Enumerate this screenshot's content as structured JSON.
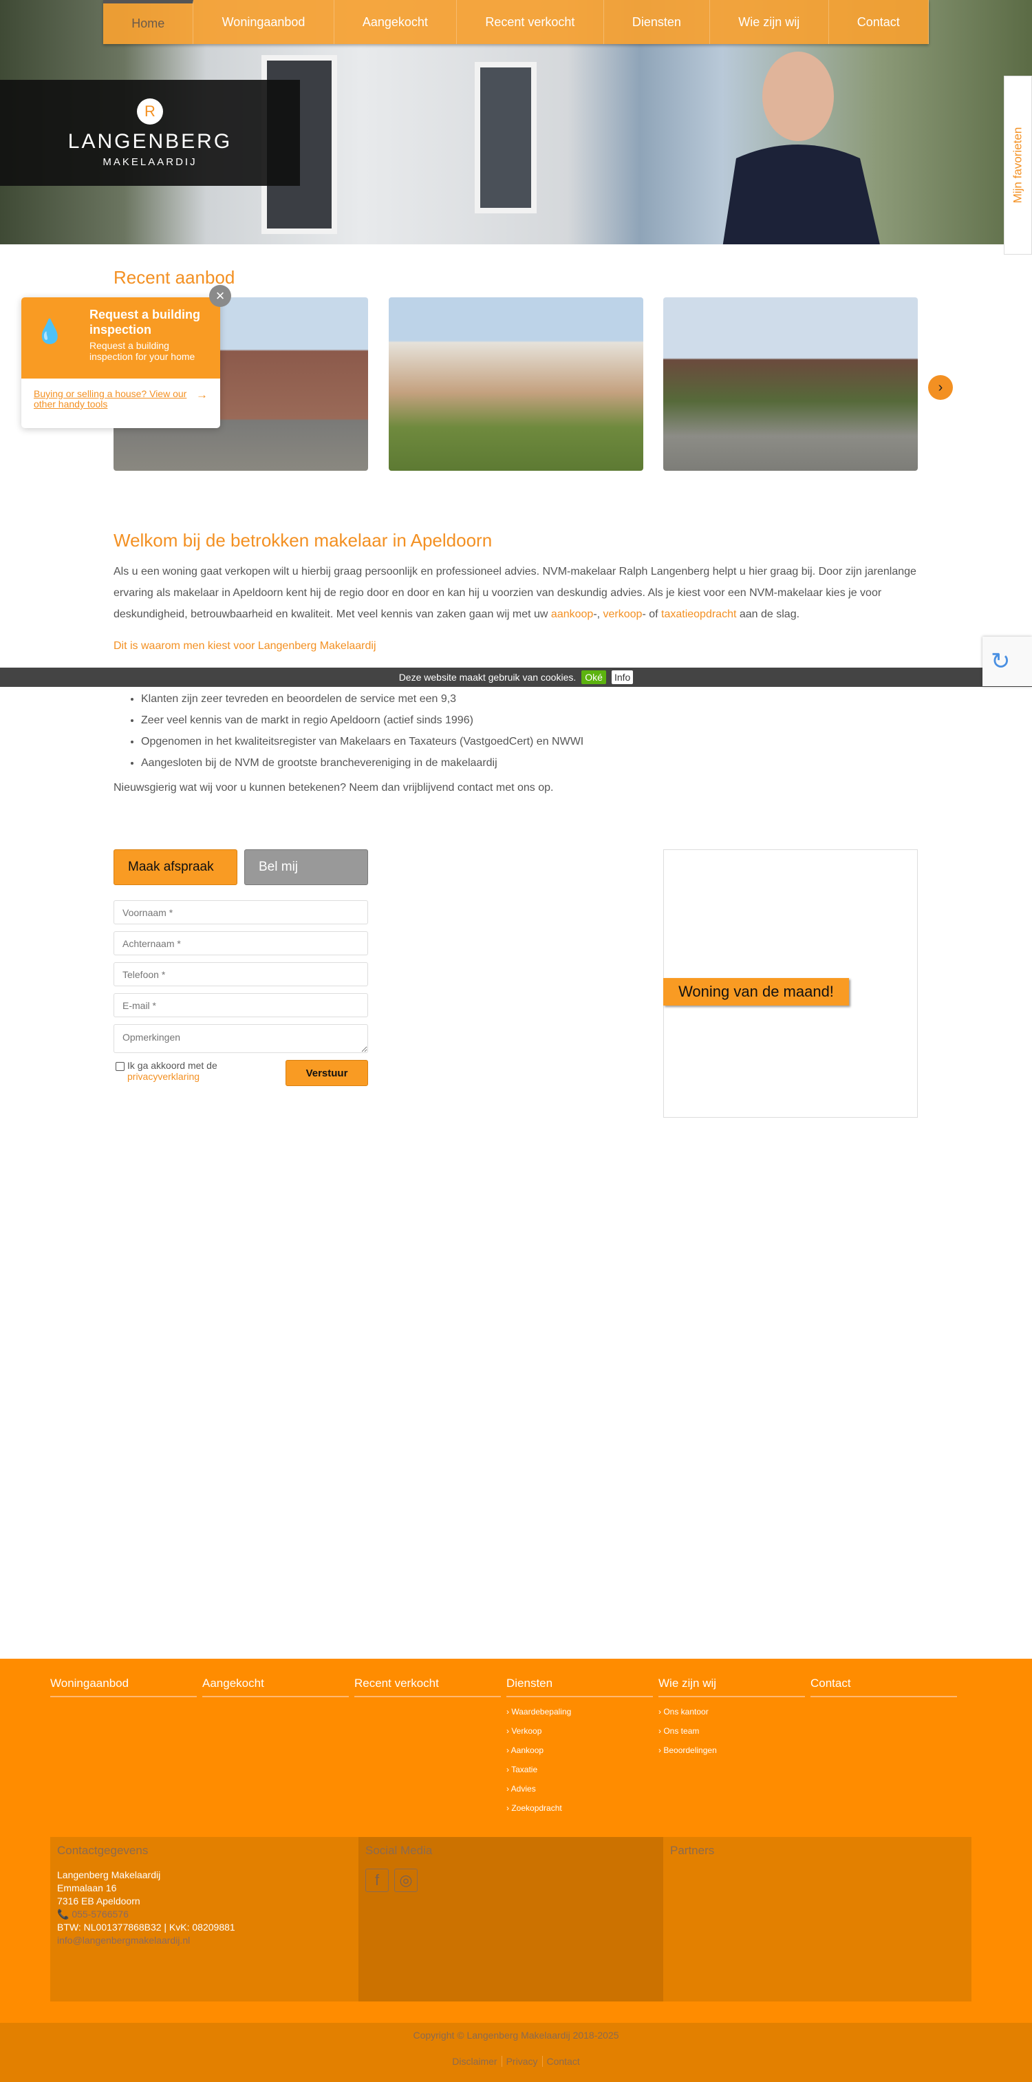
{
  "nav": {
    "items": [
      "Home",
      "Woningaanbod",
      "Aangekocht",
      "Recent verkocht",
      "Diensten",
      "Wie zijn wij",
      "Contact"
    ],
    "active": "Home"
  },
  "logo": {
    "letter": "R",
    "name": "LANGENBERG",
    "sub": "MAKELAARDIJ"
  },
  "favorites_tab": "Mijn favorieten",
  "recent": {
    "title": "Recent aanbod",
    "next_icon": "chevron-right-icon"
  },
  "popup": {
    "title": "Request a building inspection",
    "subtitle": "Request a building inspection for your home",
    "link": "Buying or selling a house? View our other handy tools",
    "close_icon": "close-icon"
  },
  "welcome": {
    "title": "Welkom bij de betrokken makelaar in Apeldoorn",
    "intro_before": "Als u een woning gaat verkopen wilt u hierbij graag persoonlijk en professioneel advies. NVM-makelaar Ralph Langenberg helpt u hier graag bij. Door zijn jarenlange ervaring als makelaar in Apeldoorn kent hij de regio door en door en kan hij u voorzien van deskundig advies. Als je kiest voor een NVM-makelaar kies je voor deskundigheid, betrouwbaarheid en kwaliteit. Met veel kennis van zaken gaan wij met uw ",
    "link1": "aankoop",
    "sep1": "-, ",
    "link2": "verkoop",
    "sep2": "- of ",
    "link3": "taxatieopdracht",
    "intro_after": "  aan de slag.",
    "why": "Dit is waarom men kiest voor Langenberg Makelaardij",
    "bullets": [
      "Klanten zijn zeer tevreden en beoordelen de service met een 9,3",
      "Zeer veel kennis van de markt in regio Apeldoorn (actief sinds 1996)",
      "Opgenomen in het kwaliteitsregister van Makelaars en Taxateurs (VastgoedCert) en NWWI",
      "Aangesloten bij de NVM de grootste branchevereniging in de makelaardij"
    ],
    "curious": "Nieuwsgierig wat wij voor u kunnen betekenen? Neem dan vrijblijvend contact met ons op."
  },
  "cookie": {
    "text": "Deze website maakt gebruik van cookies.",
    "ok": "Oké",
    "info": "Info"
  },
  "form": {
    "tab_appointment": "Maak afspraak",
    "tab_call": "Bel mij",
    "firstname_placeholder": "Voornaam *",
    "lastname_placeholder": "Achternaam *",
    "phone_placeholder": "Telefoon *",
    "email_placeholder": "E-mail *",
    "remarks_placeholder": "Opmerkingen",
    "agree": "Ik ga akkoord met de",
    "privacy": "privacyverklaring",
    "submit": "Verstuur"
  },
  "woning_van_de_maand": "Woning van de maand!",
  "footer": {
    "columns": [
      {
        "title": "Woningaanbod",
        "items": []
      },
      {
        "title": "Aangekocht",
        "items": []
      },
      {
        "title": "Recent verkocht",
        "items": []
      },
      {
        "title": "Diensten",
        "items": [
          "Waardebepaling",
          "Verkoop",
          "Aankoop",
          "Taxatie",
          "Advies",
          "Zoekopdracht"
        ]
      },
      {
        "title": "Wie zijn wij",
        "items": [
          "Ons kantoor",
          "Ons team",
          "Beoordelingen"
        ]
      },
      {
        "title": "Contact",
        "items": []
      }
    ],
    "contact": {
      "title": "Contactgegevens",
      "name": "Langenberg Makelaardij",
      "street": "Emmalaan 16",
      "city": "7316 EB Apeldoorn",
      "phone": "055-5766576",
      "btw": "BTW: NL001377868B32 | KvK: 08209881",
      "email": "info@langenbergmakelaardij.nl"
    },
    "social": {
      "title": "Social Media",
      "icons": [
        "facebook-icon",
        "instagram-icon"
      ]
    },
    "partners": {
      "title": "Partners"
    },
    "copyright": "Copyright © Langenberg Makelaardij 2018-2025",
    "links": [
      "Disclaimer",
      "Privacy",
      "Contact"
    ]
  },
  "colors": {
    "accent": "#f39022",
    "footer": "#ff8c00",
    "footer_dark": "#e38000"
  }
}
